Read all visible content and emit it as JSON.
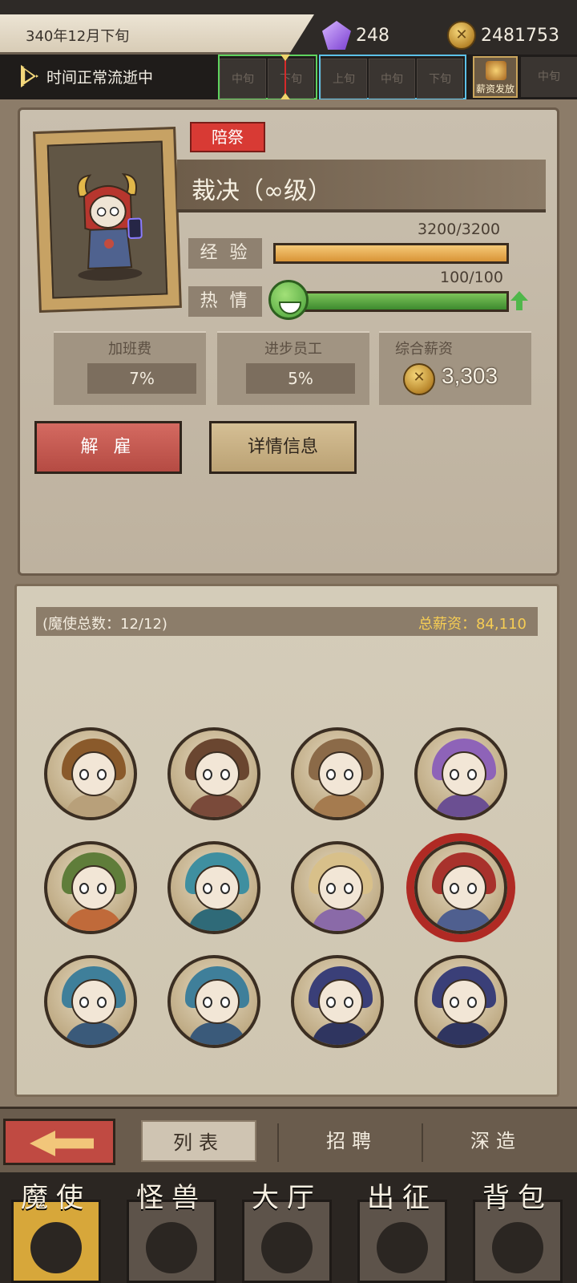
{
  "topbar": {
    "date": "340年12月下旬",
    "gems": "248",
    "gold": "2481753",
    "time_status": "时间正常流逝中",
    "slots_prev": [
      "中旬",
      "下旬"
    ],
    "slots_next": [
      "上旬",
      "中旬",
      "下旬"
    ],
    "payday_label": "薪资发放",
    "slot_last": "中旬"
  },
  "employee": {
    "role_tag": "陪祭",
    "name": "裁决（∞级）",
    "exp_label": "经 验",
    "exp_value": "3200/3200",
    "exp_fraction": 1.0,
    "passion_label": "热 情",
    "passion_value": "100/100",
    "passion_fraction": 1.0,
    "overtime_label": "加班费",
    "overtime_value": "7%",
    "progress_label": "进步员工",
    "progress_value": "5%",
    "salary_label": "综合薪资",
    "salary_value": "3,303"
  },
  "actions": {
    "fire_label": "解 雇",
    "detail_label": "详情信息"
  },
  "roster": {
    "count_text": "(魔使总数：12/12)",
    "total_salary_text": "总薪资：84,110",
    "avatars": [
      {
        "name": "avatar-witch-hat",
        "hair": "#8a5a2b",
        "body": "#b8a07a"
      },
      {
        "name": "avatar-brown-horns",
        "hair": "#6a4630",
        "body": "#7a4a3a"
      },
      {
        "name": "avatar-tan-horns",
        "hair": "#8b6a48",
        "body": "#a57b4f"
      },
      {
        "name": "avatar-purple-hood",
        "hair": "#8e63b8",
        "body": "#6b4f92"
      },
      {
        "name": "avatar-frog-hood",
        "hair": "#5f7d3a",
        "body": "#c06a3a"
      },
      {
        "name": "avatar-teal-horns",
        "hair": "#3f8fa0",
        "body": "#2f6a78"
      },
      {
        "name": "avatar-purple-horns",
        "hair": "#d8c08a",
        "body": "#8a6aa8"
      },
      {
        "name": "avatar-red-hood",
        "hair": "#a8322c",
        "body": "#4f5f8f"
      },
      {
        "name": "avatar-blue-hood-1",
        "hair": "#3f7f9a",
        "body": "#3a5a7a"
      },
      {
        "name": "avatar-blue-hood-2",
        "hair": "#3f7f9a",
        "body": "#3a5a7a"
      },
      {
        "name": "avatar-dark-hood-1",
        "hair": "#3a3f78",
        "body": "#2f3560"
      },
      {
        "name": "avatar-dark-hood-2",
        "hair": "#3a3f78",
        "body": "#2f3560"
      }
    ],
    "selected_index": 7
  },
  "tabs": {
    "list": "列表",
    "recruit": "招聘",
    "forge": "深造"
  },
  "nav": [
    {
      "label": "魔使",
      "icon": "skull-icon",
      "active": true
    },
    {
      "label": "怪兽",
      "icon": "monster-icon",
      "active": false
    },
    {
      "label": "大厅",
      "icon": "hall-icon",
      "active": false
    },
    {
      "label": "出征",
      "icon": "expedition-icon",
      "active": false
    },
    {
      "label": "背包",
      "icon": "backpack-icon",
      "active": false
    }
  ]
}
